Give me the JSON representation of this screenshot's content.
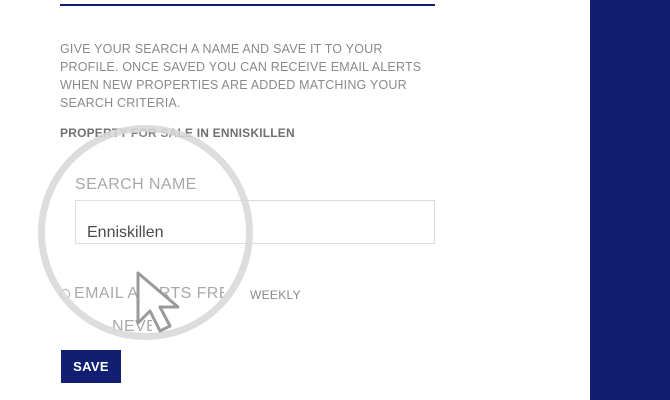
{
  "form": {
    "intro_text": "Give your search a name and save it to your profile. Once saved you can receive email alerts when new properties are added matching your search criteria.",
    "subheading": "PROPERTY FOR SALE IN ENNISKILLEN",
    "search_name_label": "SEARCH NAME",
    "search_name_value": "Enniskillen",
    "radio_option_email": "EMAIL ALERTS FREQUENCY",
    "radio_option_weekly": "WEEKLY",
    "radio_option_never": "NEVER",
    "save_label": "SAVE"
  },
  "icons": {
    "cursor": "cursor-arrow-icon",
    "magnifier": "magnifier-overlay"
  },
  "colors": {
    "brand_navy": "#121e72",
    "text_gray": "#8a8a8a"
  }
}
